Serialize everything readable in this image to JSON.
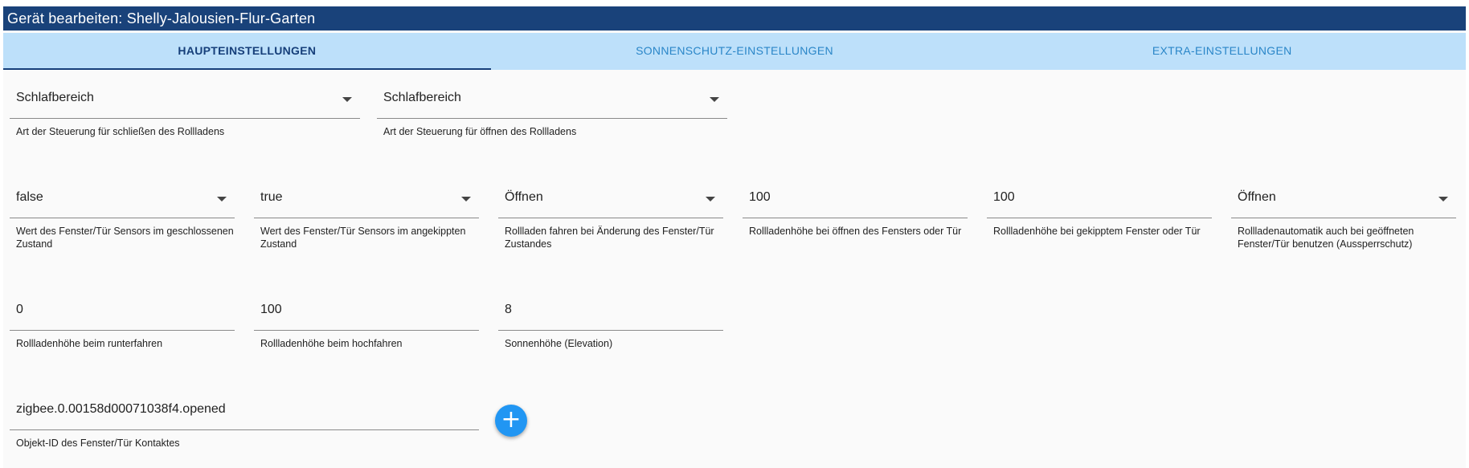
{
  "dialog": {
    "title": "Gerät bearbeiten: Shelly-Jalousien-Flur-Garten"
  },
  "tabs": [
    {
      "label": "HAUPTEINSTELLUNGEN",
      "active": true
    },
    {
      "label": "SONNENSCHUTZ-EINSTELLUNGEN",
      "active": false
    },
    {
      "label": "EXTRA-EINSTELLUNGEN",
      "active": false
    }
  ],
  "row1": [
    {
      "value": "Schlafbereich",
      "type": "select",
      "label": "Art der Steuerung für schließen des Rollladens"
    },
    {
      "value": "Schlafbereich",
      "type": "select",
      "label": "Art der Steuerung für öffnen des Rollladens"
    }
  ],
  "row2": [
    {
      "value": "false",
      "type": "select",
      "label": "Wert des Fenster/Tür Sensors im geschlossenen Zustand"
    },
    {
      "value": "true",
      "type": "select",
      "label": "Wert des Fenster/Tür Sensors im angekippten Zustand"
    },
    {
      "value": "Öffnen",
      "type": "select",
      "label": "Rollladen fahren bei Änderung des Fenster/Tür Zustandes"
    },
    {
      "value": "100",
      "type": "input",
      "label": "Rollladenhöhe bei öffnen des Fensters oder Tür"
    },
    {
      "value": "100",
      "type": "input",
      "label": "Rollladenhöhe bei gekipptem Fenster oder Tür"
    },
    {
      "value": "Öffnen",
      "type": "select",
      "label": "Rollladenautomatik auch bei geöffneten Fenster/Tür benutzen (Aussperrschutz)"
    }
  ],
  "row3": [
    {
      "value": "0",
      "type": "input",
      "label": "Rollladenhöhe beim runterfahren"
    },
    {
      "value": "100",
      "type": "input",
      "label": "Rollladenhöhe beim hochfahren"
    },
    {
      "value": "8",
      "type": "input",
      "label": "Sonnenhöhe (Elevation)"
    }
  ],
  "row4": [
    {
      "value": "zigbee.0.00158d00071038f4.opened",
      "type": "input",
      "label": "Objekt-ID des Fenster/Tür Kontaktes"
    }
  ],
  "add_button": {
    "icon": "plus-icon",
    "glyph": "+"
  }
}
